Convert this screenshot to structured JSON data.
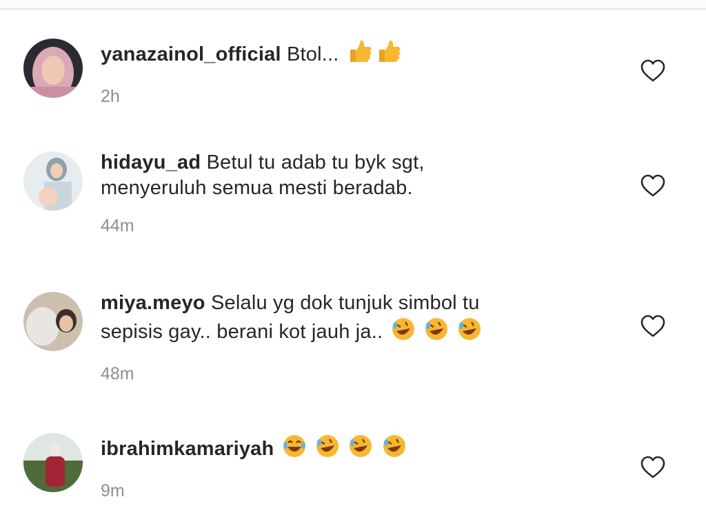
{
  "comments": [
    {
      "username": "yanazainol_official",
      "text": "Btol...",
      "emojis": [
        "thumbs-up",
        "thumbs-up"
      ],
      "time": "2h"
    },
    {
      "username": "hidayu_ad",
      "text": "Betul tu adab tu byk sgt,",
      "text_line2": "menyeruluh semua mesti beradab.",
      "emojis": [],
      "time": "44m"
    },
    {
      "username": "miya.meyo",
      "text": "Selalu yg dok tunjuk simbol tu",
      "text_line2": "sepisis gay.. berani kot jauh ja..",
      "emojis": [
        "rolling-laughing",
        "rolling-laughing",
        "rolling-laughing"
      ],
      "time": "48m"
    },
    {
      "username": "ibrahimkamariyah",
      "text": "",
      "emojis": [
        "joy",
        "rolling-laughing",
        "rolling-laughing",
        "rolling-laughing"
      ],
      "time": "9m"
    }
  ],
  "colors": {
    "username": "#262626",
    "text": "#262626",
    "time": "#8e8e8e",
    "heart": "#262626",
    "emoji_yellow": "#F7B733"
  }
}
